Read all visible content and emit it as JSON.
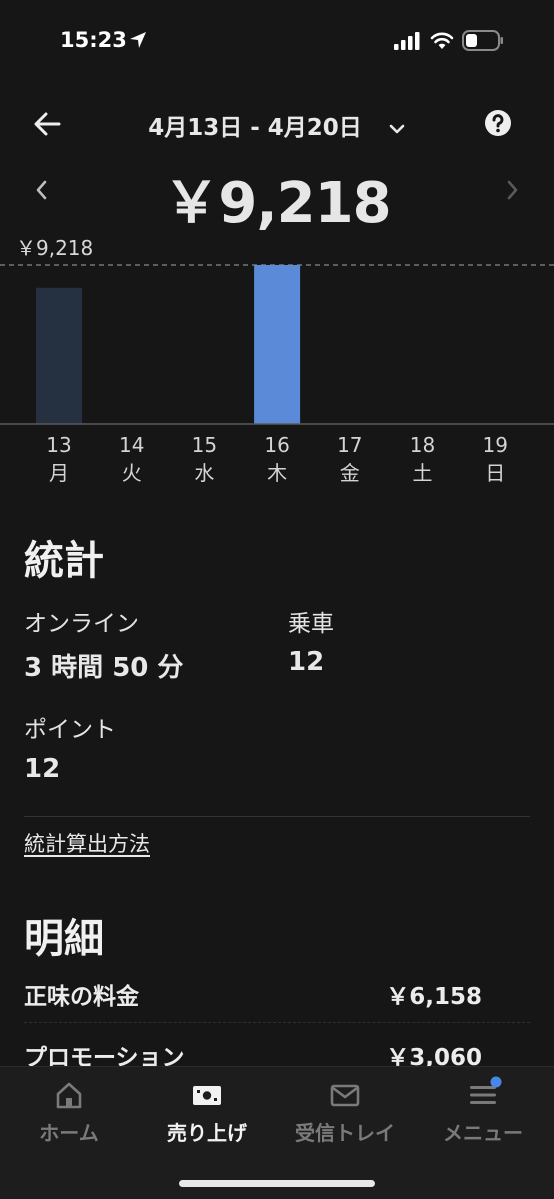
{
  "status_bar": {
    "time": "15:23",
    "icons": [
      "location-arrow-icon",
      "cellular-signal-icon",
      "wifi-icon",
      "battery-icon"
    ]
  },
  "header": {
    "date_range": "4月13日 - 4月20日",
    "icons": {
      "back": "back-arrow-icon",
      "dropdown": "chevron-down-icon",
      "help": "help-icon"
    }
  },
  "earnings": {
    "total": "￥9,218"
  },
  "chart_data": {
    "type": "bar",
    "max_label": "￥9,218",
    "categories": [
      {
        "date": "13",
        "day": "月"
      },
      {
        "date": "14",
        "day": "火"
      },
      {
        "date": "15",
        "day": "水"
      },
      {
        "date": "16",
        "day": "木"
      },
      {
        "date": "17",
        "day": "金"
      },
      {
        "date": "18",
        "day": "土"
      },
      {
        "date": "19",
        "day": "日"
      }
    ],
    "values": [
      7900,
      0,
      0,
      9218,
      0,
      0,
      0
    ],
    "ylim": [
      0,
      9218
    ],
    "selected_index": 3,
    "colors": {
      "bar": "#253040",
      "selected_bar": "#5b8ad9"
    }
  },
  "stats": {
    "title": "統計",
    "online_label": "オンライン",
    "online_value": "3 時間 50 分",
    "rides_label": "乗車",
    "rides_value": "12",
    "points_label": "ポイント",
    "points_value": "12",
    "method_link": "統計算出方法"
  },
  "breakdown": {
    "title": "明細",
    "rows": [
      {
        "label": "正味の料金",
        "value": "￥6,158"
      },
      {
        "label": "プロモーション",
        "value": "￥3,060"
      }
    ]
  },
  "bottom_nav": {
    "items": [
      {
        "label": "ホーム",
        "icon": "home-icon"
      },
      {
        "label": "売り上げ",
        "icon": "earnings-icon"
      },
      {
        "label": "受信トレイ",
        "icon": "mail-icon"
      },
      {
        "label": "メニュー",
        "icon": "menu-icon"
      }
    ],
    "active_index": 1,
    "accent": "#4a86e8"
  }
}
